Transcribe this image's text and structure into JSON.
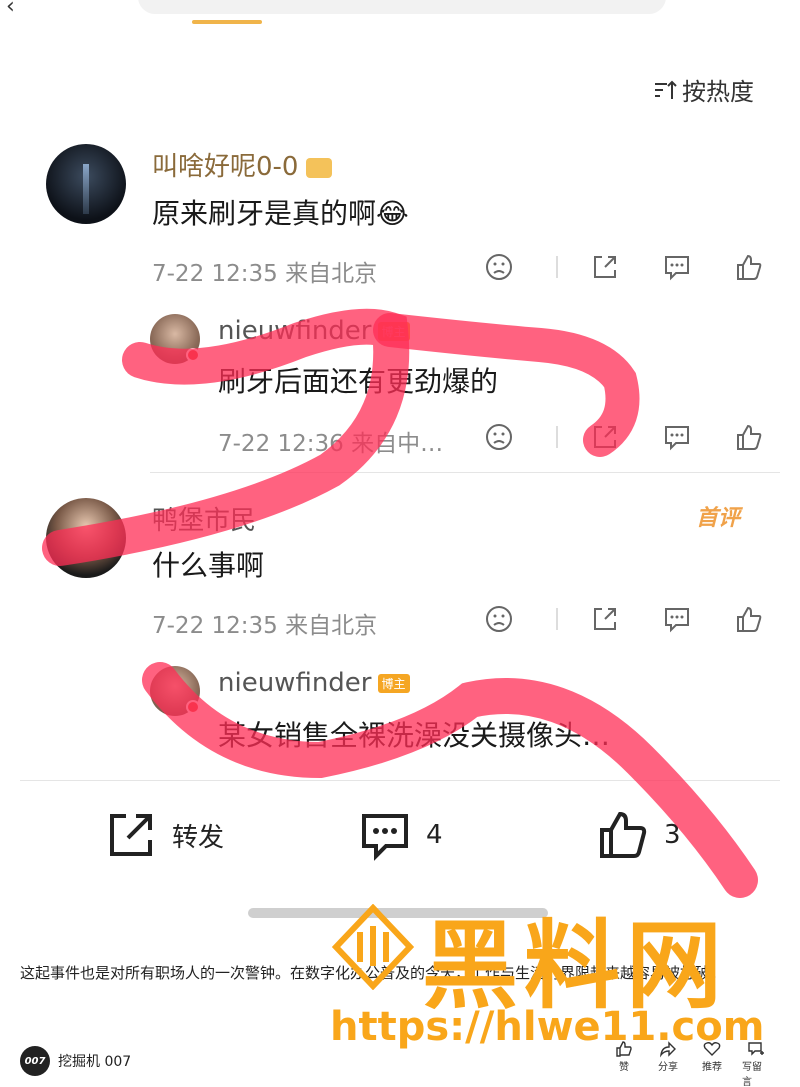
{
  "header": {
    "sort_label": "按热度"
  },
  "comments": [
    {
      "user": "叫啥好呢0-0",
      "text": "原来刷牙是真的啊😂",
      "meta": "7-22 12:35 来自北京"
    },
    {
      "user": "nieuwfinder",
      "tag": "博主",
      "text": "刷牙后面还有更劲爆的",
      "meta": "7-22 12:36 来自中…"
    },
    {
      "user": "鸭堡市民",
      "badge": "首评",
      "text": "什么事啊",
      "meta": "7-22 12:35 来自北京"
    },
    {
      "user": "nieuwfinder",
      "tag": "博主",
      "text": "某女销售全裸洗澡没关摄像头…"
    }
  ],
  "bottom_bar": {
    "repost_label": "转发",
    "comment_count": "4",
    "like_count": "3"
  },
  "article": {
    "text": "这起事件也是对所有职场人的一次警钟。在数字化办公普及的今天，工作与生活的界限越来越容易被打破。"
  },
  "footer": {
    "author_logo": "007",
    "author_name": "挖掘机 007",
    "actions": [
      "赞",
      "分享",
      "推荐",
      "写留言"
    ]
  },
  "watermark": {
    "title": "黑料网",
    "url": "https://hlwe11.com"
  },
  "colors": {
    "accent": "#f0b44a",
    "scribble": "#ff2d55",
    "watermark": "#f9a61a",
    "username": "#8a6a3a"
  }
}
